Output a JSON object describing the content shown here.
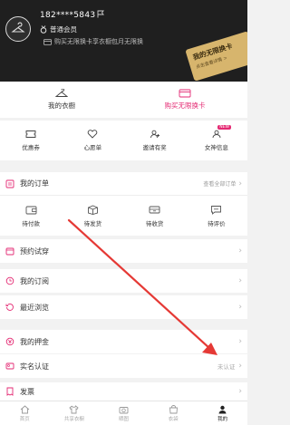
{
  "header": {
    "phone": "182****5843",
    "member_level": "普通会员",
    "promo_text": "购买无限换卡享衣橱包月无限换",
    "vip_card_title": "我的无限换卡",
    "vip_card_sub": "点击查看详情 >"
  },
  "wardrobe": {
    "left_label": "我的衣橱",
    "right_label": "购买无限换卡"
  },
  "tools": [
    {
      "label": "优惠券",
      "icon": "coupon-icon"
    },
    {
      "label": "心愿单",
      "icon": "heart-icon"
    },
    {
      "label": "邀请有奖",
      "icon": "invite-icon"
    },
    {
      "label": "女神信息",
      "icon": "profile-icon",
      "badge": "NEW"
    }
  ],
  "orders": {
    "title": "我的订单",
    "view_all": "查看全部订单",
    "items": [
      {
        "label": "待付款",
        "icon": "wallet-icon"
      },
      {
        "label": "待发货",
        "icon": "box-icon"
      },
      {
        "label": "待收货",
        "icon": "truck-icon"
      },
      {
        "label": "待评价",
        "icon": "comment-icon"
      }
    ]
  },
  "list": [
    {
      "label": "预约试穿",
      "value": ""
    },
    {
      "label": "我的订阅",
      "value": ""
    },
    {
      "label": "最近浏览",
      "value": ""
    },
    {
      "label": "我的押金",
      "value": ""
    },
    {
      "label": "实名认证",
      "value": "未认证"
    },
    {
      "label": "发票",
      "value": ""
    }
  ],
  "nav": [
    {
      "label": "首页",
      "icon": "home-icon"
    },
    {
      "label": "共享衣橱",
      "icon": "wardrobe-icon"
    },
    {
      "label": "晒图",
      "icon": "camera-icon"
    },
    {
      "label": "衣袋",
      "icon": "bag-icon"
    },
    {
      "label": "我的",
      "icon": "user-icon",
      "active": true
    }
  ],
  "colors": {
    "accent": "#e42a73",
    "header_bg": "#1f1f1f",
    "vip_gold": "#d7b56d",
    "annotation_arrow": "#e53935"
  }
}
